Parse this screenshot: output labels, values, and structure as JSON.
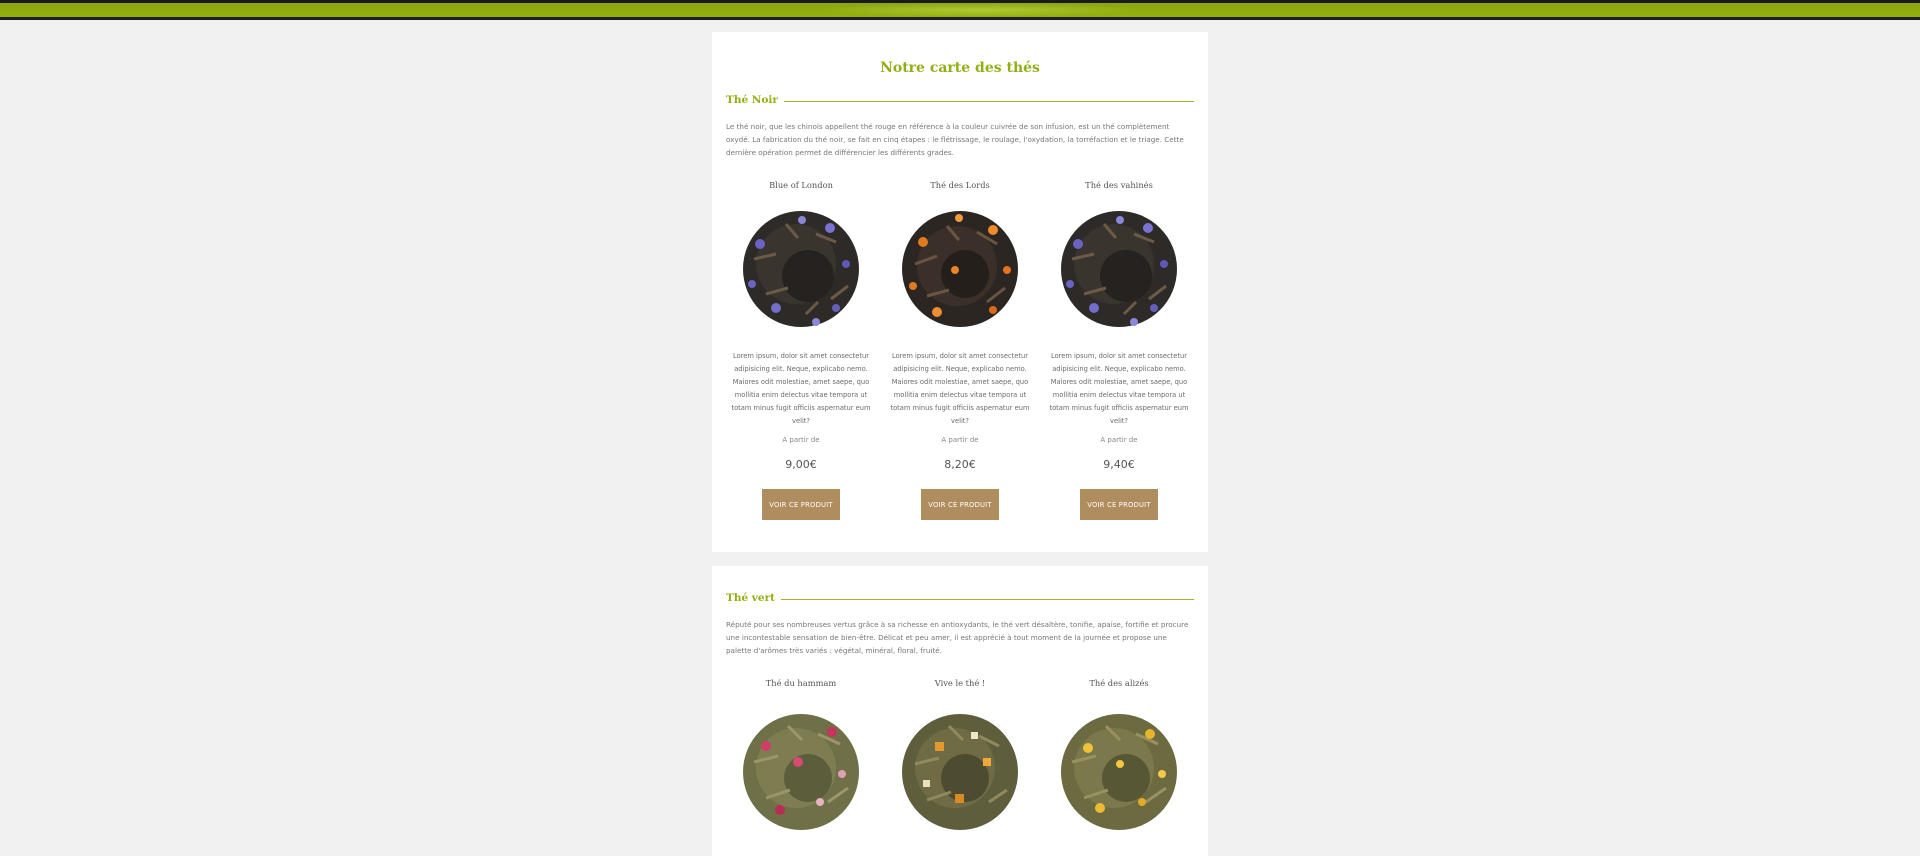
{
  "page": {
    "title": "Notre carte des thés"
  },
  "sections": [
    {
      "title": "Thé Noir",
      "description": "Le thé noir, que les chinois appellent thé rouge en référence à la couleur cuivrée de son infusion, est un thé complètement oxydé. La fabrication du thé noir, se fait en cinq étapes : le flétrissage, le roulage, l'oxydation, la torréfaction et le triage. Cette dernière opération permet de différencier les différents grades.",
      "products": [
        {
          "name": "Blue of London",
          "image_icon": "black-tea-blue-flowers-icon",
          "description": "Lorem ipsum, dolor sit amet consectetur adipisicing elit. Neque, explicabo nemo. Maiores odit molestiae, amet saepe, quo mollitia enim delectus vitae tempora ut totam minus fugit officiis aspernatur eum velit?",
          "price_prefix": "A partir de",
          "price": "9,00€",
          "button": "VOIR CE PRODUIT"
        },
        {
          "name": "Thé des Lords",
          "image_icon": "black-tea-orange-petals-icon",
          "description": "Lorem ipsum, dolor sit amet consectetur adipisicing elit. Neque, explicabo nemo. Maiores odit molestiae, amet saepe, quo mollitia enim delectus vitae tempora ut totam minus fugit officiis aspernatur eum velit?",
          "price_prefix": "A partir de",
          "price": "8,20€",
          "button": "VOIR CE PRODUIT"
        },
        {
          "name": "Thé des vahinés",
          "image_icon": "black-tea-blue-flowers-icon",
          "description": "Lorem ipsum, dolor sit amet consectetur adipisicing elit. Neque, explicabo nemo. Maiores odit molestiae, amet saepe, quo mollitia enim delectus vitae tempora ut totam minus fugit officiis aspernatur eum velit?",
          "price_prefix": "A partir de",
          "price": "9,40€",
          "button": "VOIR CE PRODUIT"
        }
      ]
    },
    {
      "title": "Thé vert",
      "description": "Réputé pour ses nombreuses vertus grâce à sa richesse en antioxydants, le thé vert désaltère, tonifie, apaise, fortifie et procure une incontestable sensation de bien-être. Délicat et peu amer, il est apprécié à tout moment de la journée et propose une palette d'arômes très variés : végétal, minéral, floral, fruité.",
      "products": [
        {
          "name": "Thé du hammam",
          "image_icon": "green-tea-rose-petals-icon"
        },
        {
          "name": "Vive le thé !",
          "image_icon": "green-tea-orange-pieces-icon"
        },
        {
          "name": "Thé des alizés",
          "image_icon": "green-tea-yellow-petals-icon"
        }
      ]
    }
  ],
  "colors": {
    "accent_green": "#8fb012",
    "button_brown": "#b08d5f",
    "background": "#f1f1f1"
  }
}
